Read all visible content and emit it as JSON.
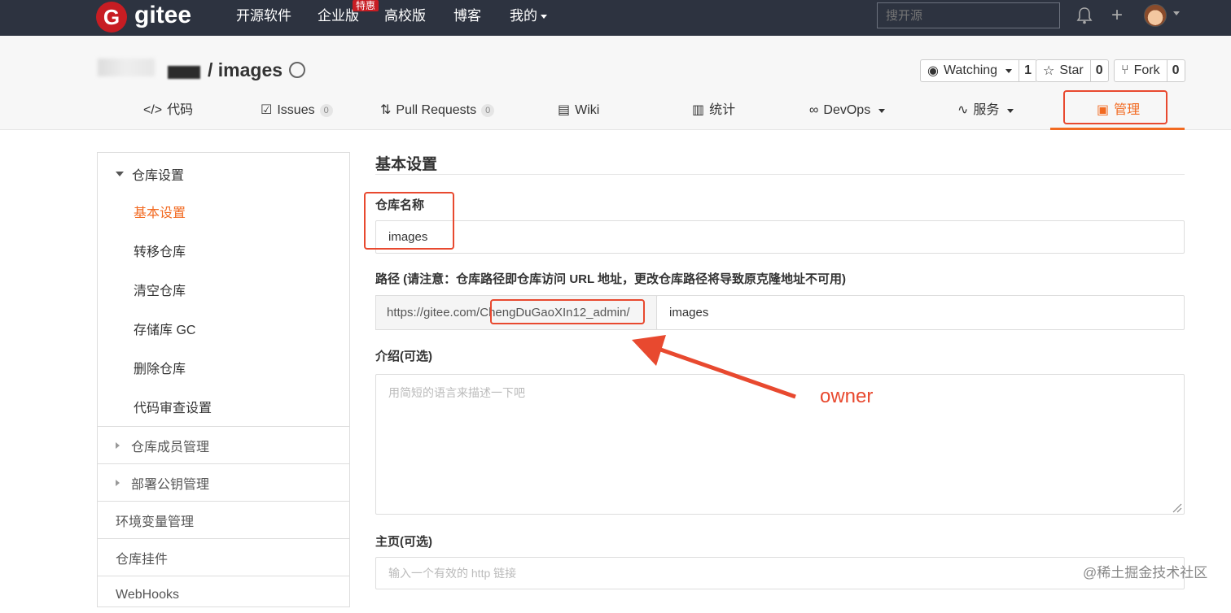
{
  "topnav": {
    "logo_letter": "G",
    "logo_text": "gitee",
    "items": [
      "开源软件",
      "企业版",
      "高校版",
      "博客",
      "我的"
    ],
    "promo_badge": "特惠",
    "search_placeholder": "搜开源",
    "plus": "+"
  },
  "repo": {
    "title": "/ images",
    "watching": {
      "label": "Watching",
      "count": "1"
    },
    "star": {
      "label": "Star",
      "count": "0"
    },
    "fork": {
      "label": "Fork",
      "count": "0"
    }
  },
  "tabs": [
    {
      "icon": "</>",
      "label": "代码"
    },
    {
      "icon": "☑",
      "label": "Issues",
      "count": "0"
    },
    {
      "icon": "⇅",
      "label": "Pull Requests",
      "count": "0"
    },
    {
      "icon": "▤",
      "label": "Wiki"
    },
    {
      "icon": "▥",
      "label": "统计"
    },
    {
      "icon": "∞",
      "label": "DevOps"
    },
    {
      "icon": "∿",
      "label": "服务"
    },
    {
      "icon": "▣",
      "label": "管理"
    }
  ],
  "sidebar": {
    "head": "仓库设置",
    "items": [
      "基本设置",
      "转移仓库",
      "清空仓库",
      "存储库 GC",
      "删除仓库",
      "代码审查设置"
    ],
    "sections": [
      "仓库成员管理",
      "部署公钥管理",
      "环境变量管理",
      "仓库挂件",
      "WebHooks"
    ]
  },
  "form": {
    "title": "基本设置",
    "name_label": "仓库名称",
    "name_value": "images",
    "path_label": "路径 (请注意：仓库路径即仓库访问 URL 地址，更改仓库路径将导致原克隆地址不可用)",
    "path_prefix": "https://gitee.com/",
    "path_owner": "ChengDuGaoXIn12_admin/",
    "path_value": "images",
    "intro_label": "介绍(可选)",
    "intro_placeholder": "用简短的语言来描述一下吧",
    "homepage_label": "主页(可选)",
    "homepage_placeholder": "输入一个有效的 http 链接"
  },
  "annotation": {
    "owner_label": "owner",
    "color": "#e8492f"
  },
  "watermark": "@稀土掘金技术社区",
  "colors": {
    "nav_bg": "#2d3340",
    "accent": "#f26a21",
    "brand": "#c71d23"
  }
}
